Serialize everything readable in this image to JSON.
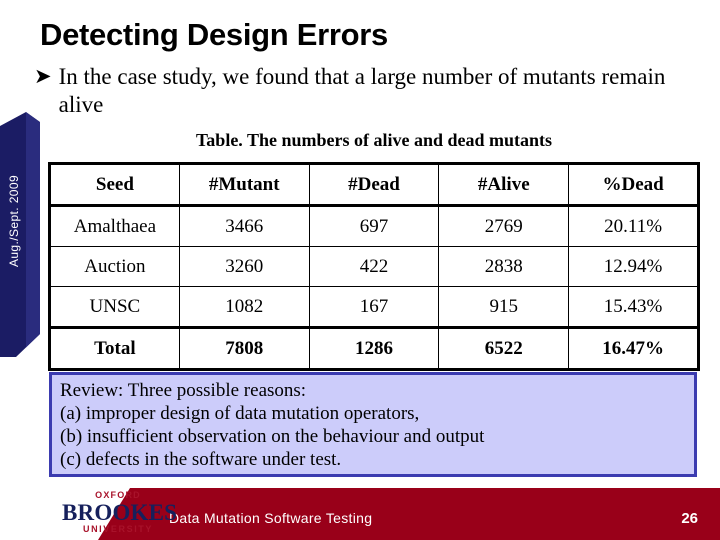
{
  "side_tab": {
    "label": "Aug./Sept. 2009"
  },
  "slide": {
    "title": "Detecting Design Errors",
    "bullet_icon": "arrowhead-bullet-icon",
    "bullet_text": "In the case study, we found that a large number of mutants remain alive"
  },
  "table": {
    "caption": "Table. The numbers of alive and dead mutants",
    "columns": [
      "Seed",
      "#Mutant",
      "#Dead",
      "#Alive",
      "%Dead"
    ],
    "rows": [
      [
        "Amalthaea",
        "3466",
        "697",
        "2769",
        "20.11%"
      ],
      [
        "Auction",
        "3260",
        "422",
        "2838",
        "12.94%"
      ],
      [
        "UNSC",
        "1082",
        "167",
        "915",
        "15.43%"
      ]
    ],
    "total_row": [
      "Total",
      "7808",
      "1286",
      "6522",
      "16.47%"
    ]
  },
  "review": {
    "lines": [
      "Review: Three possible reasons:",
      "(a) improper design of data mutation operators,",
      "(b) insufficient observation on the behaviour and output",
      "(c) defects in the software under test."
    ],
    "fill_color": "#ccccfa",
    "border_color": "#3b3bb0"
  },
  "footer": {
    "title": "Data Mutation Software Testing",
    "page_number": "26",
    "band_color": "#990019",
    "logo": {
      "line1": "OXFORD",
      "line2": "BROOKES",
      "line3": "UNIVERSITY",
      "red": "#a8122a",
      "navy": "#16205c"
    }
  }
}
